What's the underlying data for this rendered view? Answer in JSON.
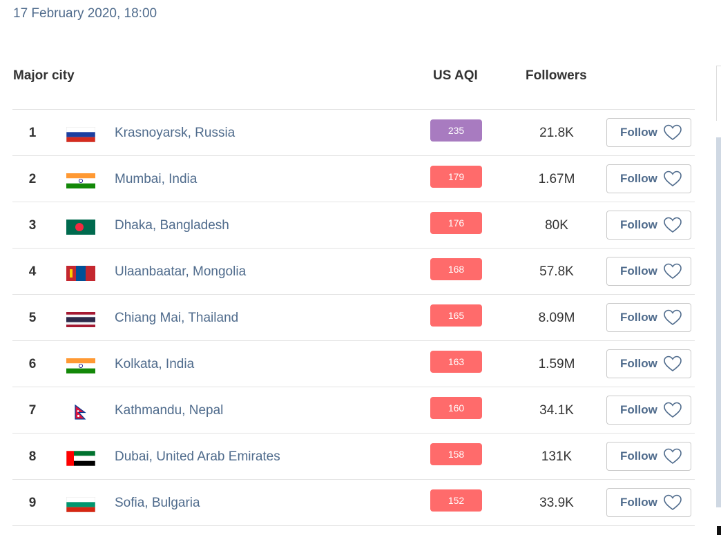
{
  "timestamp": "17 February 2020, 18:00",
  "headers": {
    "city": "Major city",
    "aqi": "US AQI",
    "followers": "Followers"
  },
  "follow_label": "Follow",
  "colors": {
    "very_unhealthy": "#a87bc0",
    "unhealthy": "#ff6b6b"
  },
  "rows": [
    {
      "rank": "1",
      "city": "Krasnoyarsk, Russia",
      "aqi": "235",
      "followers": "21.8K",
      "flag": "russia-flag-icon",
      "level": "very_unhealthy"
    },
    {
      "rank": "2",
      "city": "Mumbai, India",
      "aqi": "179",
      "followers": "1.67M",
      "flag": "india-flag-icon",
      "level": "unhealthy"
    },
    {
      "rank": "3",
      "city": "Dhaka, Bangladesh",
      "aqi": "176",
      "followers": "80K",
      "flag": "bangladesh-flag-icon",
      "level": "unhealthy"
    },
    {
      "rank": "4",
      "city": "Ulaanbaatar, Mongolia",
      "aqi": "168",
      "followers": "57.8K",
      "flag": "mongolia-flag-icon",
      "level": "unhealthy"
    },
    {
      "rank": "5",
      "city": "Chiang Mai, Thailand",
      "aqi": "165",
      "followers": "8.09M",
      "flag": "thailand-flag-icon",
      "level": "unhealthy"
    },
    {
      "rank": "6",
      "city": "Kolkata, India",
      "aqi": "163",
      "followers": "1.59M",
      "flag": "india-flag-icon",
      "level": "unhealthy"
    },
    {
      "rank": "7",
      "city": "Kathmandu, Nepal",
      "aqi": "160",
      "followers": "34.1K",
      "flag": "nepal-flag-icon",
      "level": "unhealthy"
    },
    {
      "rank": "8",
      "city": "Dubai, United Arab Emirates",
      "aqi": "158",
      "followers": "131K",
      "flag": "uae-flag-icon",
      "level": "unhealthy"
    },
    {
      "rank": "9",
      "city": "Sofia, Bulgaria",
      "aqi": "152",
      "followers": "33.9K",
      "flag": "bulgaria-flag-icon",
      "level": "unhealthy"
    }
  ]
}
